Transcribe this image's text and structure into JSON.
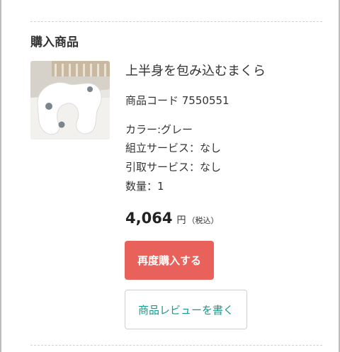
{
  "section": {
    "title": "購入商品"
  },
  "product": {
    "image_alt": "U字型の抱きまくら",
    "name": "上半身を包み込むまくら",
    "code_line": "商品コード 7550551",
    "color_line": "カラー:グレー",
    "assembly_line": "組立サービス：なし",
    "pickup_line": "引取サービス：なし",
    "quantity_line": "数量：1",
    "price": {
      "amount": "4,064",
      "unit": "円",
      "tax_note": "（税込）"
    }
  },
  "actions": {
    "reorder_label": "再度購入する",
    "review_label": "商品レビューを書く"
  },
  "colors": {
    "reorder_button": "#e8615a",
    "review_text": "#159a8c",
    "divider": "#d0d0d0"
  }
}
